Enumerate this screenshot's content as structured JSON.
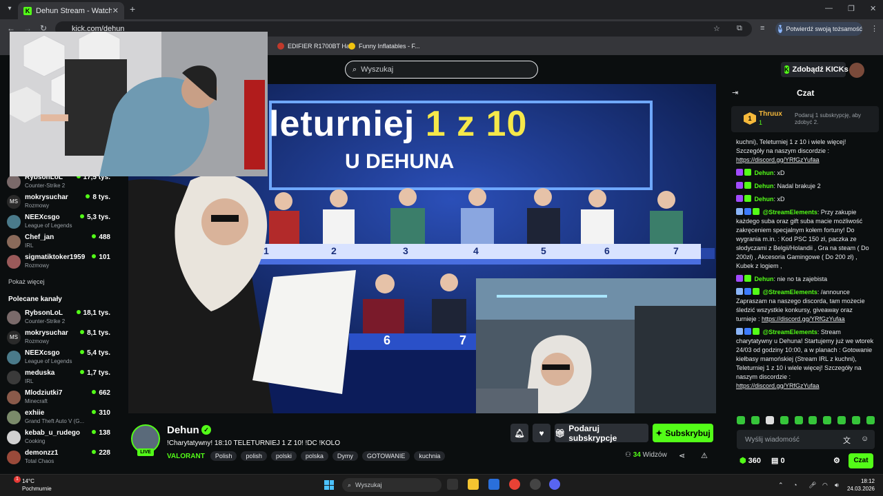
{
  "browser": {
    "tab_title": "Dehun Stream - Watch Live on",
    "tab_close": "✕",
    "new_tab": "+",
    "url": "kick.com/dehun",
    "profile_label": "Potwierdź swoją tożsamość",
    "bookmarks": [
      {
        "label": "EDIFIER R1700BT Ha...",
        "color": "#c0392b"
      },
      {
        "label": "Funny Inflatables - F...",
        "color": "#f1c40f"
      }
    ]
  },
  "kick": {
    "search_placeholder": "Wyszukaj",
    "kicks_label": "Zdobądź KICKs"
  },
  "sidebar": {
    "following": [
      {
        "name": "RybsonLoL",
        "category": "Counter-Strike 2",
        "viewers": "17,5 tys."
      },
      {
        "name": "mokrysuchar",
        "category": "Rozmowy",
        "viewers": "8 tys."
      },
      {
        "name": "NEEXcsgo",
        "category": "League of Legends",
        "viewers": "5,3 tys."
      },
      {
        "name": "Chef_jan",
        "category": "IRL",
        "viewers": "488"
      },
      {
        "name": "sigmatiktoker1959",
        "category": "Rozmowy",
        "viewers": "101"
      }
    ],
    "show_more": "Pokaż więcej",
    "recommended_title": "Polecane kanały",
    "recommended": [
      {
        "name": "RybsonLoL",
        "category": "Counter-Strike 2",
        "viewers": "18,1 tys."
      },
      {
        "name": "mokrysuchar",
        "category": "Rozmowy",
        "viewers": "8,1 tys."
      },
      {
        "name": "NEEXcsgo",
        "category": "League of Legends",
        "viewers": "5,4 tys."
      },
      {
        "name": "meduska",
        "category": "IRL",
        "viewers": "1,7 tys."
      },
      {
        "name": "Mlodziutki7",
        "category": "Minecraft",
        "viewers": "662"
      },
      {
        "name": "exhiie",
        "category": "Grand Theft Auto V (G...",
        "viewers": "310"
      },
      {
        "name": "kebab_u_rudego",
        "category": "Cooking",
        "viewers": "138"
      },
      {
        "name": "demonzz1",
        "category": "Total Chaos",
        "viewers": "228"
      }
    ]
  },
  "video": {
    "show_title_a": "leturniej ",
    "show_title_b": "1 z 10",
    "show_subtitle": "U DEHUNA",
    "podium_numbers": [
      "1",
      "2",
      "3",
      "4",
      "5",
      "6",
      "7"
    ],
    "back_numbers": [
      "6",
      "7"
    ]
  },
  "stream": {
    "channel": "Dehun",
    "live": "LIVE",
    "title": "!Charytatywny! 18:10 TELETURNIEJ 1 Z 10!  !DC !KOLO",
    "game": "VALORANT",
    "tags": [
      "Polish",
      "polish",
      "polski",
      "polska",
      "Dymy",
      "GOTOWANIE",
      "kuchnia"
    ],
    "gift_label": "Podaruj subskrypcje",
    "subscribe_label": "Subskrybuj",
    "viewers_count": "34",
    "viewers_label": "Widzów"
  },
  "chat": {
    "title": "Czat",
    "pinned": {
      "rank": "1",
      "user": "Thruux",
      "count": "1",
      "text": "Podaruj 1 subskrypcję, aby zdobyć 2."
    },
    "messages": [
      {
        "user": "",
        "text": "kuchni), Teleturniej 1 z 10 i wiele więcej! Szczegóły na naszym discordzie :",
        "link": "https://discord.gg/YRfGzYufaa"
      },
      {
        "user": "Dehun",
        "text": "xD",
        "link": ""
      },
      {
        "user": "Dehun",
        "text": "Nadal brakuje 2",
        "link": ""
      },
      {
        "user": "Dehun",
        "text": "xD",
        "link": ""
      },
      {
        "user": "@StreamElements",
        "text": "Przy zakupie każdego suba oraz gift suba macie możliwość zakręceniem specjalnym kołem fortuny! Do wygrania m.in. : Kod PSC 150 zł, paczka ze słodyczami z Belgii/Holandii , Gra na steam ( Do 200zł) , Akcesoria Gamingowe ( Do 200 zł) , Kubek z logiem ,",
        "link": ""
      },
      {
        "user": "Dehun",
        "text": "nie no ta zajebista",
        "link": ""
      },
      {
        "user": "@StreamElements",
        "text": "/announce Zapraszam na naszego discorda, tam możecie śledzić wszystkie konkursy, giveaway oraz turnieje :",
        "link": "https://discord.gg/YRfGzYufaa"
      },
      {
        "user": "@StreamElements",
        "text": "Stream charytatywny u Dehuna! Startujemy już we wtorek 24/03 od godziny 10:00, a w planach : Gotowanie kiełbasy mamońskiej (Stream IRL z kuchni), Teleturniej 1 z 10 i wiele więcej! Szczegóły na naszym discordzie :",
        "link": "https://discord.gg/YRfGzYufaa"
      }
    ],
    "input_placeholder": "Wyślij wiadomość",
    "kicks_balance": "360",
    "store_count": "0",
    "chat_button": "Czat"
  },
  "taskbar": {
    "weather_temp": "14°C",
    "weather_desc": "Pochmurnie",
    "weather_alert": "1",
    "search_placeholder": "Wyszukaj",
    "time": "18:12",
    "date": "24.03.2026"
  },
  "colors": {
    "accent": "#53fc18",
    "gold": "#f6b93b",
    "background": "#0b0e0f"
  }
}
